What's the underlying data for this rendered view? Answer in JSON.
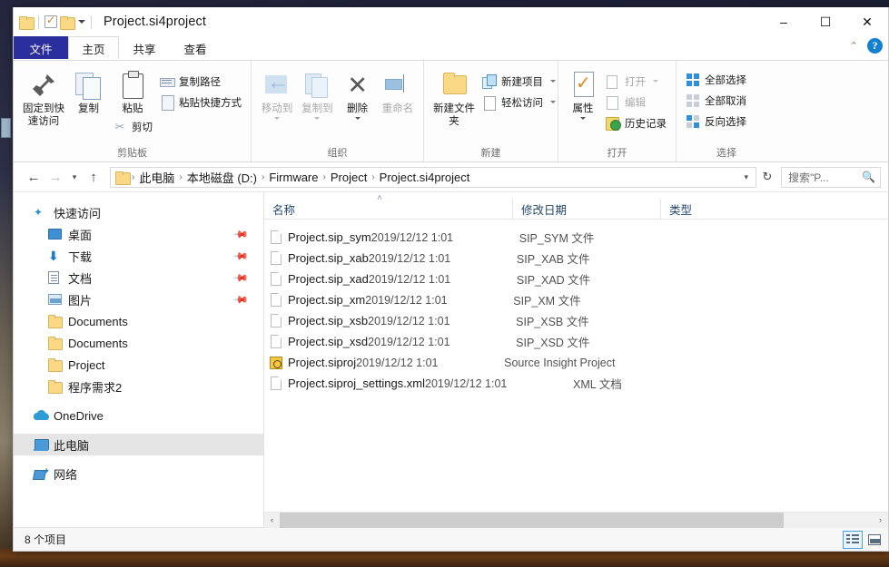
{
  "window": {
    "title": "Project.si4project",
    "quick_access": [
      {
        "name": "folder-icon",
        "label": ""
      },
      {
        "name": "properties-icon",
        "label": ""
      },
      {
        "name": "new-folder-icon",
        "label": ""
      }
    ],
    "controls": {
      "minimize": "–",
      "maximize": "☐",
      "close": "✕",
      "collapse_ribbon": "⌃",
      "help": "?"
    }
  },
  "tabs": [
    {
      "label": "文件",
      "kind": "file"
    },
    {
      "label": "主页",
      "kind": "active"
    },
    {
      "label": "共享",
      "kind": "normal"
    },
    {
      "label": "查看",
      "kind": "normal"
    }
  ],
  "ribbon": {
    "groups": [
      {
        "label": "剪贴板",
        "big": [
          {
            "label": "固定到快速访问",
            "icon": "pin-icon",
            "disabled": false
          },
          {
            "label": "复制",
            "icon": "copy-icon",
            "disabled": false
          },
          {
            "label": "粘贴",
            "icon": "paste-icon",
            "disabled": false
          }
        ],
        "small": [
          {
            "label": "复制路径",
            "icon": "copy-path-icon"
          },
          {
            "label": "粘贴快捷方式",
            "icon": "paste-shortcut-icon"
          },
          {
            "label": "剪切",
            "icon": "cut-icon"
          }
        ]
      },
      {
        "label": "组织",
        "big": [
          {
            "label": "移动到",
            "icon": "move-to-icon",
            "disabled": true
          },
          {
            "label": "复制到",
            "icon": "copy-to-icon",
            "disabled": true
          },
          {
            "label": "删除",
            "icon": "delete-icon",
            "disabled": false
          },
          {
            "label": "重命名",
            "icon": "rename-icon",
            "disabled": true
          }
        ]
      },
      {
        "label": "新建",
        "big": [
          {
            "label": "新建文件夹",
            "icon": "new-folder-icon",
            "disabled": false
          }
        ],
        "small": [
          {
            "label": "新建项目",
            "icon": "new-item-icon",
            "caret": true
          },
          {
            "label": "轻松访问",
            "icon": "easy-access-icon",
            "caret": true
          }
        ]
      },
      {
        "label": "打开",
        "big": [
          {
            "label": "属性",
            "icon": "properties-icon",
            "disabled": false
          }
        ],
        "small": [
          {
            "label": "打开",
            "icon": "open-icon",
            "caret": true,
            "disabled": true
          },
          {
            "label": "编辑",
            "icon": "edit-icon",
            "disabled": true
          },
          {
            "label": "历史记录",
            "icon": "history-icon",
            "disabled": false
          }
        ]
      },
      {
        "label": "选择",
        "small": [
          {
            "label": "全部选择",
            "icon": "select-all-icon"
          },
          {
            "label": "全部取消",
            "icon": "select-none-icon"
          },
          {
            "label": "反向选择",
            "icon": "invert-selection-icon"
          }
        ]
      }
    ]
  },
  "address": {
    "back": "←",
    "forward": "→",
    "recent_caret": "▾",
    "up": "↑",
    "breadcrumbs": [
      "此电脑",
      "本地磁盘 (D:)",
      "Firmware",
      "Project",
      "Project.si4project"
    ],
    "separator": "›",
    "dropdown": "▾",
    "refresh": "↻"
  },
  "search": {
    "placeholder": "搜索\"P...",
    "icon": "search-icon"
  },
  "sidebar": {
    "items": [
      {
        "label": "快速访问",
        "icon": "star-icon",
        "level": 1,
        "pinned": false,
        "selected": false
      },
      {
        "label": "桌面",
        "icon": "desktop-icon",
        "level": 2,
        "pinned": true,
        "selected": false
      },
      {
        "label": "下载",
        "icon": "download-icon",
        "level": 2,
        "pinned": true,
        "selected": false
      },
      {
        "label": "文档",
        "icon": "documents-icon",
        "level": 2,
        "pinned": true,
        "selected": false
      },
      {
        "label": "图片",
        "icon": "pictures-icon",
        "level": 2,
        "pinned": true,
        "selected": false
      },
      {
        "label": "Documents",
        "icon": "folder-icon",
        "level": 2,
        "pinned": false,
        "selected": false
      },
      {
        "label": "Documents",
        "icon": "folder-icon",
        "level": 2,
        "pinned": false,
        "selected": false
      },
      {
        "label": "Project",
        "icon": "folder-icon",
        "level": 2,
        "pinned": false,
        "selected": false
      },
      {
        "label": "程序需求2",
        "icon": "folder-icon",
        "level": 2,
        "pinned": false,
        "selected": false
      },
      {
        "label": "OneDrive",
        "icon": "onedrive-icon",
        "level": 1,
        "pinned": false,
        "selected": false
      },
      {
        "label": "此电脑",
        "icon": "this-pc-icon",
        "level": 1,
        "pinned": false,
        "selected": true
      },
      {
        "label": "网络",
        "icon": "network-icon",
        "level": 1,
        "pinned": false,
        "selected": false
      }
    ]
  },
  "file_list": {
    "columns": [
      {
        "label": "名称",
        "sorted": true,
        "sort_dir": "asc"
      },
      {
        "label": "修改日期",
        "sorted": false
      },
      {
        "label": "类型",
        "sorted": false
      }
    ],
    "sort_glyph": "˄",
    "rows": [
      {
        "name": "Project.sip_sym",
        "date": "2019/12/12 1:01",
        "type": "SIP_SYM 文件",
        "icon": "file-icon"
      },
      {
        "name": "Project.sip_xab",
        "date": "2019/12/12 1:01",
        "type": "SIP_XAB 文件",
        "icon": "file-icon"
      },
      {
        "name": "Project.sip_xad",
        "date": "2019/12/12 1:01",
        "type": "SIP_XAD 文件",
        "icon": "file-icon"
      },
      {
        "name": "Project.sip_xm",
        "date": "2019/12/12 1:01",
        "type": "SIP_XM 文件",
        "icon": "file-icon"
      },
      {
        "name": "Project.sip_xsb",
        "date": "2019/12/12 1:01",
        "type": "SIP_XSB 文件",
        "icon": "file-icon"
      },
      {
        "name": "Project.sip_xsd",
        "date": "2019/12/12 1:01",
        "type": "SIP_XSD 文件",
        "icon": "file-icon"
      },
      {
        "name": "Project.siproj",
        "date": "2019/12/12 1:01",
        "type": "Source Insight Project",
        "icon": "siproj-icon"
      },
      {
        "name": "Project.siproj_settings.xml",
        "date": "2019/12/12 1:01",
        "type": "XML 文档",
        "icon": "file-icon"
      }
    ]
  },
  "scrollbar": {
    "left_arrow": "‹",
    "right_arrow": "›"
  },
  "status": {
    "item_count": "8 个项目",
    "views": [
      {
        "name": "details-view",
        "active": true
      },
      {
        "name": "large-icons-view",
        "active": false
      }
    ]
  },
  "colors": {
    "file_tab_blue": "#2b2f9e",
    "accent_blue": "#1680d0",
    "selection_grey": "#e5e5e5",
    "column_header_text": "#25486b",
    "folder_yellow": "#fbd984"
  }
}
